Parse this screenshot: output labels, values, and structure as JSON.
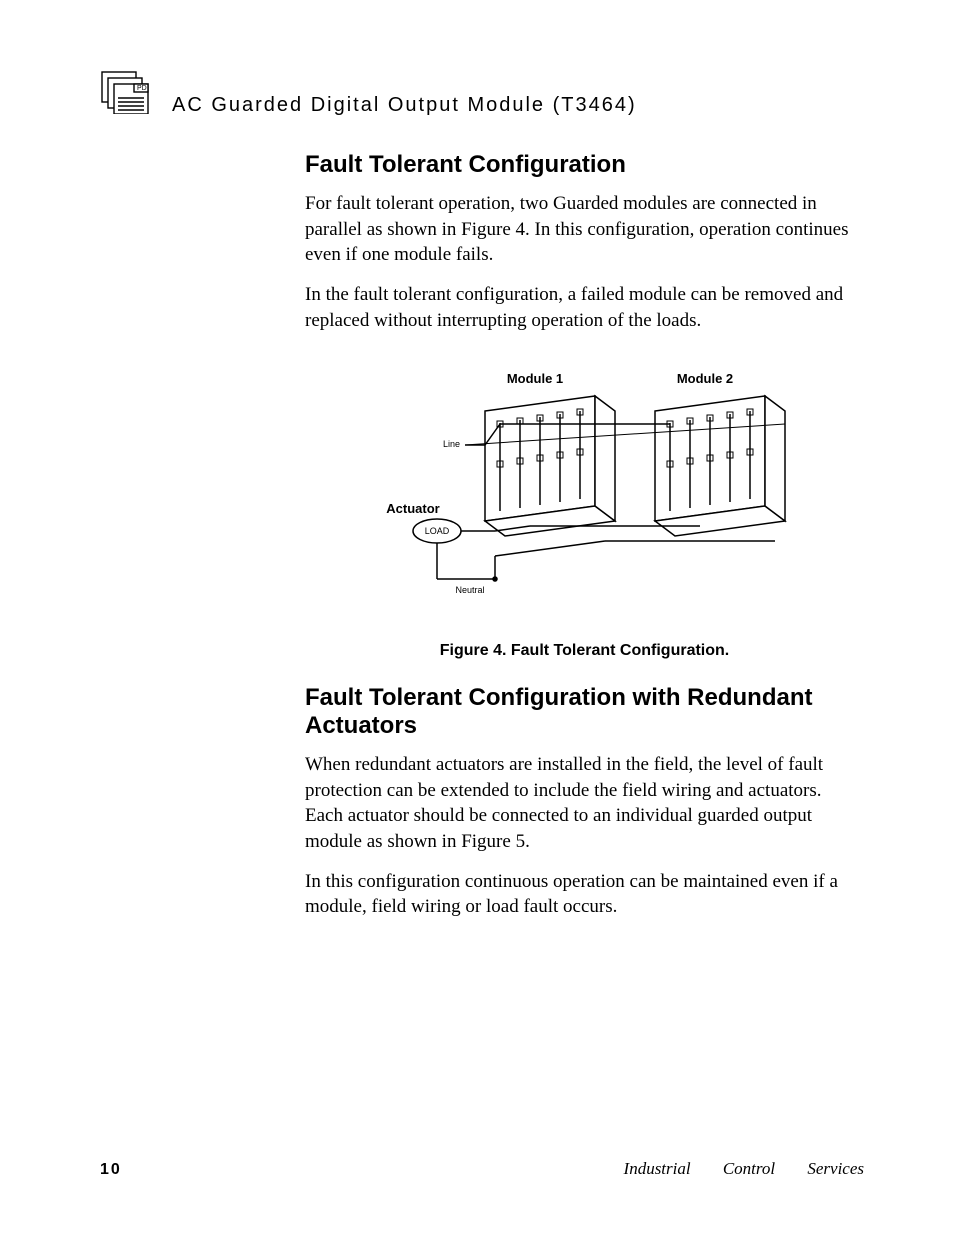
{
  "header": {
    "icon_label": "PD",
    "title": "AC  Guarded  Digital  Output  Module (T3464)"
  },
  "section1": {
    "heading": "Fault Tolerant Configuration",
    "para1": "For fault tolerant operation, two Guarded modules are connected in parallel as shown in Figure 4.  In this configuration, operation continues even if one module fails.",
    "para2": "In the fault tolerant configuration, a failed module can be removed and replaced without interrupting operation of the loads."
  },
  "figure": {
    "caption": "Figure 4.  Fault Tolerant Configuration.",
    "labels": {
      "module1": "Module 1",
      "module2": "Module 2",
      "line": "Line",
      "actuator": "Actuator",
      "load": "LOAD",
      "neutral": "Neutral"
    }
  },
  "section2": {
    "heading": "Fault Tolerant Configuration with Redundant Actuators",
    "para1": "When redundant actuators are installed in the field, the level of fault protection can be extended to include the field wiring and actuators.  Each actuator should be connected to an individual guarded output module as shown in Figure 5.",
    "para2": "In this configuration continuous operation can be maintained even if a module, field wiring or load fault occurs."
  },
  "footer": {
    "page": "10",
    "text": "Industrial Control Services"
  }
}
